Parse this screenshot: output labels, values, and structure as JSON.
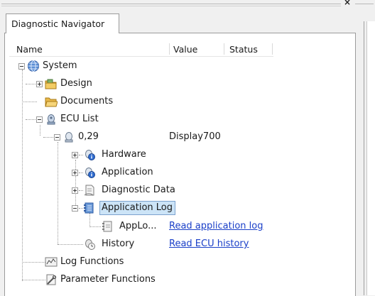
{
  "window": {
    "close_glyph": "×"
  },
  "tab": {
    "label": "Diagnostic Navigator"
  },
  "columns": {
    "name": "Name",
    "value": "Value",
    "status": "Status"
  },
  "tree": {
    "system": {
      "label": "System",
      "icon": "globe-icon"
    },
    "design": {
      "label": "Design",
      "icon": "folder-icon"
    },
    "documents": {
      "label": "Documents",
      "icon": "folder-open-icon"
    },
    "ecu_list": {
      "label": "ECU List",
      "icon": "ecu-list-icon"
    },
    "ecu": {
      "label": "0,29",
      "value": "Display700",
      "icon": "ecu-icon"
    },
    "hardware": {
      "label": "Hardware",
      "icon": "info-gear-icon"
    },
    "application": {
      "label": "Application",
      "icon": "info-gear-icon"
    },
    "diagnostic_data": {
      "label": "Diagnostic Data",
      "icon": "document-icon"
    },
    "application_log": {
      "label": "Application Log",
      "icon": "log-icon",
      "selected": true
    },
    "applog_entry": {
      "label": "AppLo...",
      "value": "Read application log",
      "icon": "log-entry-icon"
    },
    "history": {
      "label": "History",
      "value": "Read ECU history",
      "icon": "history-icon"
    },
    "log_functions": {
      "label": "Log Functions",
      "icon": "log-functions-icon"
    },
    "parameter_functions": {
      "label": "Parameter Functions",
      "icon": "wrench-icon"
    }
  },
  "colors": {
    "selection": "#cce4f7",
    "link": "#1a3fc8"
  }
}
